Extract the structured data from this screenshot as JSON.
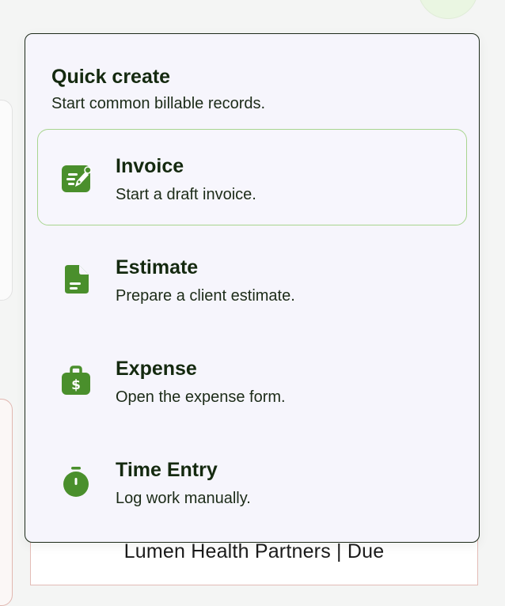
{
  "quick_create": {
    "title": "Quick create",
    "subtitle": "Start common billable records.",
    "items": [
      {
        "title": "Invoice",
        "description": "Start a draft invoice.",
        "icon": "invoice-edit-icon"
      },
      {
        "title": "Estimate",
        "description": "Prepare a client estimate.",
        "icon": "document-icon"
      },
      {
        "title": "Expense",
        "description": "Open the expense form.",
        "icon": "money-bag-icon"
      },
      {
        "title": "Time Entry",
        "description": "Log work manually.",
        "icon": "stopwatch-icon"
      }
    ]
  },
  "background": {
    "row_text": "Lumen Health Partners | Due"
  },
  "colors": {
    "accent": "#4a8f2c",
    "active_border": "#a8d58f",
    "popover_bg": "#f6f5fc",
    "text": "#14290f"
  }
}
